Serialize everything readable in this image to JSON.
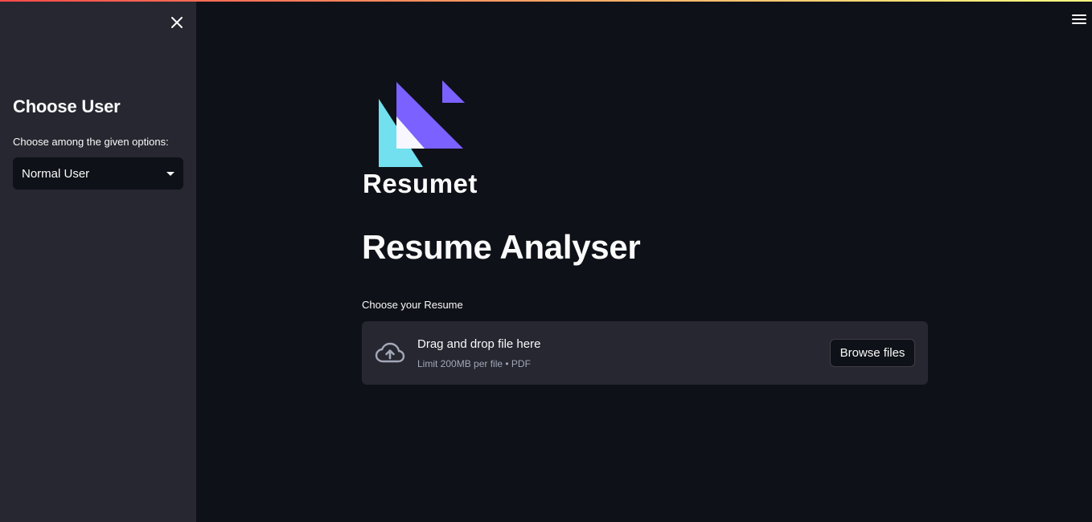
{
  "sidebar": {
    "title": "Choose User",
    "select_label": "Choose among the given options:",
    "select_value": "Normal User"
  },
  "main": {
    "logo_text": "Resumet",
    "title": "Resume Analyser",
    "upload_label": "Choose your Resume",
    "dropzone_title": "Drag and drop file here",
    "dropzone_subtitle": "Limit 200MB per file • PDF",
    "browse_label": "Browse files"
  },
  "icons": [
    "close-icon",
    "hamburger-menu-icon",
    "caret-down-icon",
    "cloud-upload-icon",
    "resumet-logo"
  ],
  "colors": {
    "background": "#0e1117",
    "sidebar": "#262730",
    "text": "#fafafa",
    "muted": "#a3a8b8",
    "logo_purple": "#7b61ff",
    "logo_cyan": "#72e0ef"
  }
}
